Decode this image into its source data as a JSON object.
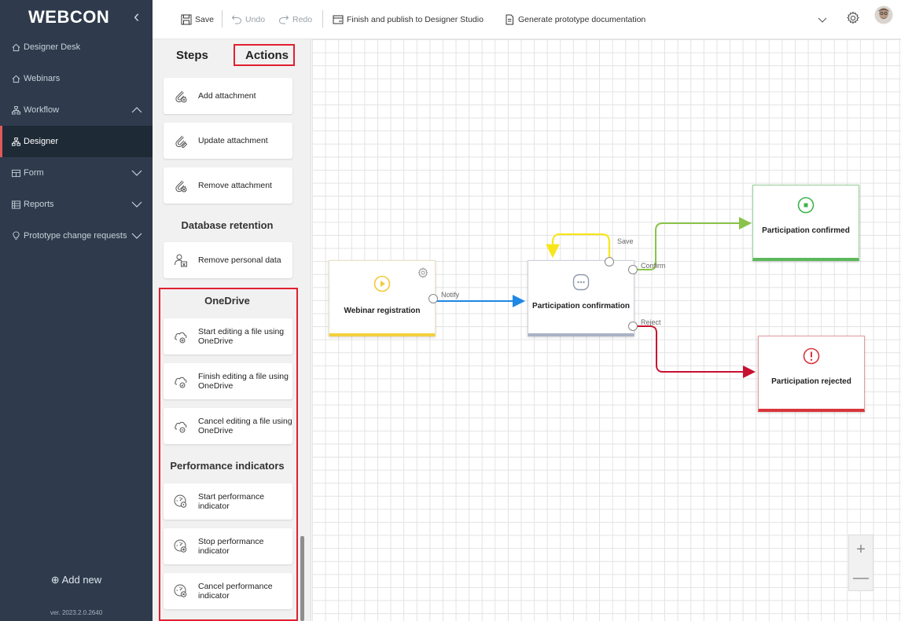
{
  "sidebar": {
    "logo": "WEBCON",
    "items": [
      {
        "label": "Designer Desk"
      },
      {
        "label": "Webinars"
      },
      {
        "label": "Workflow"
      },
      {
        "label": "Designer"
      },
      {
        "label": "Form"
      },
      {
        "label": "Reports"
      },
      {
        "label": "Prototype change requests"
      }
    ],
    "add_new": "⊕ Add new",
    "version": "ver. 2023.2.0.2640"
  },
  "toolbar": {
    "save": "Save",
    "undo": "Undo",
    "redo": "Redo",
    "publish": "Finish and publish to Designer Studio",
    "docs": "Generate prototype documentation"
  },
  "palette": {
    "tabs": {
      "steps": "Steps",
      "actions": "Actions"
    },
    "attachments": [
      {
        "label": "Add attachment",
        "icon": "add-attachment-icon"
      },
      {
        "label": "Update attachment",
        "icon": "update-attachment-icon"
      },
      {
        "label": "Remove attachment",
        "icon": "remove-attachment-icon"
      }
    ],
    "database_retention": {
      "title": "Database retention",
      "items": [
        {
          "label": "Remove personal data",
          "icon": "remove-personal-data-icon"
        }
      ]
    },
    "onedrive": {
      "title": "OneDrive",
      "items": [
        {
          "label": "Start editing a file using OneDrive",
          "icon": "cloud-add-icon"
        },
        {
          "label": "Finish editing a file using OneDrive",
          "icon": "cloud-check-icon"
        },
        {
          "label": "Cancel editing a file using OneDrive",
          "icon": "cloud-remove-icon"
        }
      ]
    },
    "performance": {
      "title": "Performance indicators",
      "items": [
        {
          "label": "Start performance indicator",
          "icon": "gauge-play-icon"
        },
        {
          "label": "Stop performance indicator",
          "icon": "gauge-stop-icon"
        },
        {
          "label": "Cancel performance indicator",
          "icon": "gauge-cancel-icon"
        }
      ]
    }
  },
  "diagram": {
    "nodes": {
      "registration": "Webinar registration",
      "confirmation": "Participation confirmation",
      "confirmed": "Participation confirmed",
      "rejected": "Participation rejected"
    },
    "paths": {
      "notify": "Notify",
      "save": "Save",
      "confirm": "Confirm",
      "reject": "Reject"
    },
    "colors": {
      "start": "#f3d03e",
      "intermediate": "#a9b3c4",
      "success": "#5cb85c",
      "fail": "#d9343b",
      "notify": "#1e88e5",
      "save": "#f7e61a",
      "confirm": "#8bc34a",
      "reject": "#c8102e"
    }
  },
  "zoom": {
    "in": "+",
    "out": "—"
  }
}
